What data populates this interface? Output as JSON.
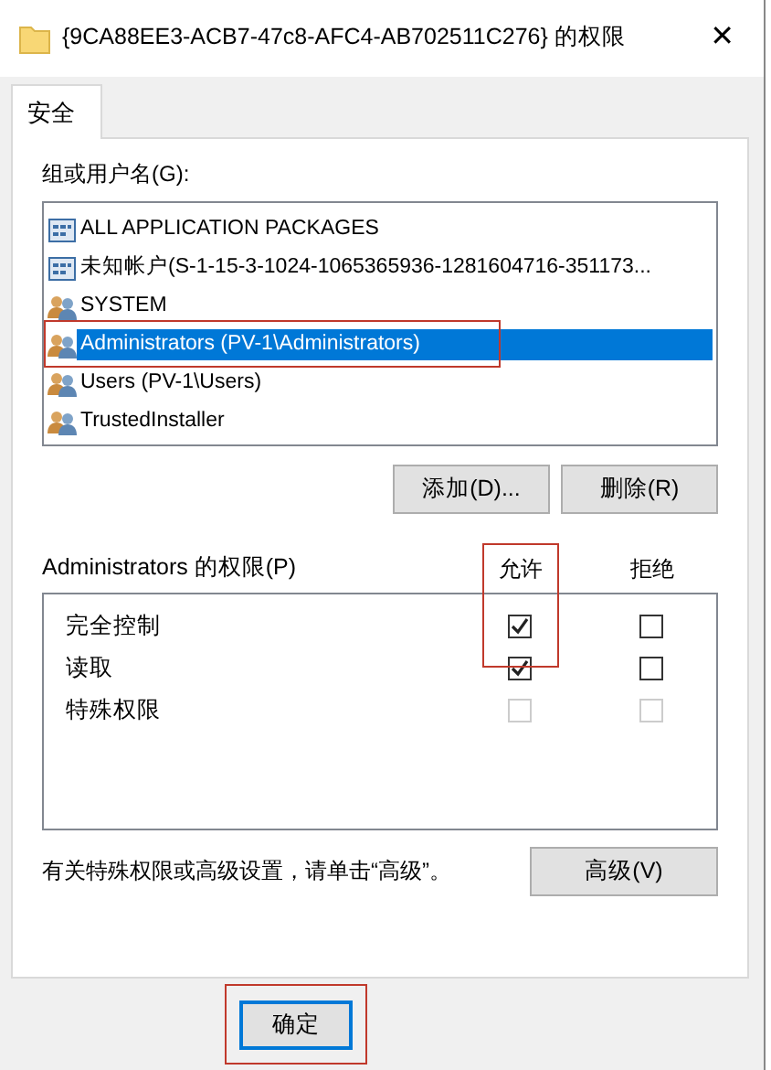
{
  "window": {
    "title": "{9CA88EE3-ACB7-47c8-AFC4-AB702511C276} 的权限",
    "close": "✕"
  },
  "tabs": [
    {
      "label": "安全",
      "selected": true
    }
  ],
  "groups": {
    "label": "组或用户名(G):",
    "items": [
      {
        "name": "ALL APPLICATION PACKAGES",
        "kind": "package",
        "selected": false,
        "highlighted": false
      },
      {
        "name": "未知帐户(S-1-15-3-1024-1065365936-1281604716-351173...",
        "kind": "package",
        "selected": false,
        "highlighted": false
      },
      {
        "name": "SYSTEM",
        "kind": "group",
        "selected": false,
        "highlighted": false
      },
      {
        "name": "Administrators (PV-1\\Administrators)",
        "kind": "group",
        "selected": true,
        "highlighted": true
      },
      {
        "name": "Users (PV-1\\Users)",
        "kind": "group",
        "selected": false,
        "highlighted": false
      },
      {
        "name": "TrustedInstaller",
        "kind": "group",
        "selected": false,
        "highlighted": false
      }
    ],
    "buttons": [
      "添加(D)...",
      "删除(R)"
    ]
  },
  "permissions": {
    "label": "Administrators 的权限(P)",
    "allow_header": "允许",
    "deny_header": "拒绝",
    "allow_highlighted": true,
    "rows": [
      {
        "name": "完全控制",
        "allow": true,
        "deny": false,
        "disabled": false
      },
      {
        "name": "读取",
        "allow": true,
        "deny": false,
        "disabled": false
      },
      {
        "name": "特殊权限",
        "allow": false,
        "deny": false,
        "disabled": true
      }
    ]
  },
  "advanced": {
    "text": "有关特殊权限或高级设置，请单击“高级”。",
    "button": "高级(V)"
  },
  "footer": {
    "ok": "确定",
    "ok_highlighted": true
  }
}
